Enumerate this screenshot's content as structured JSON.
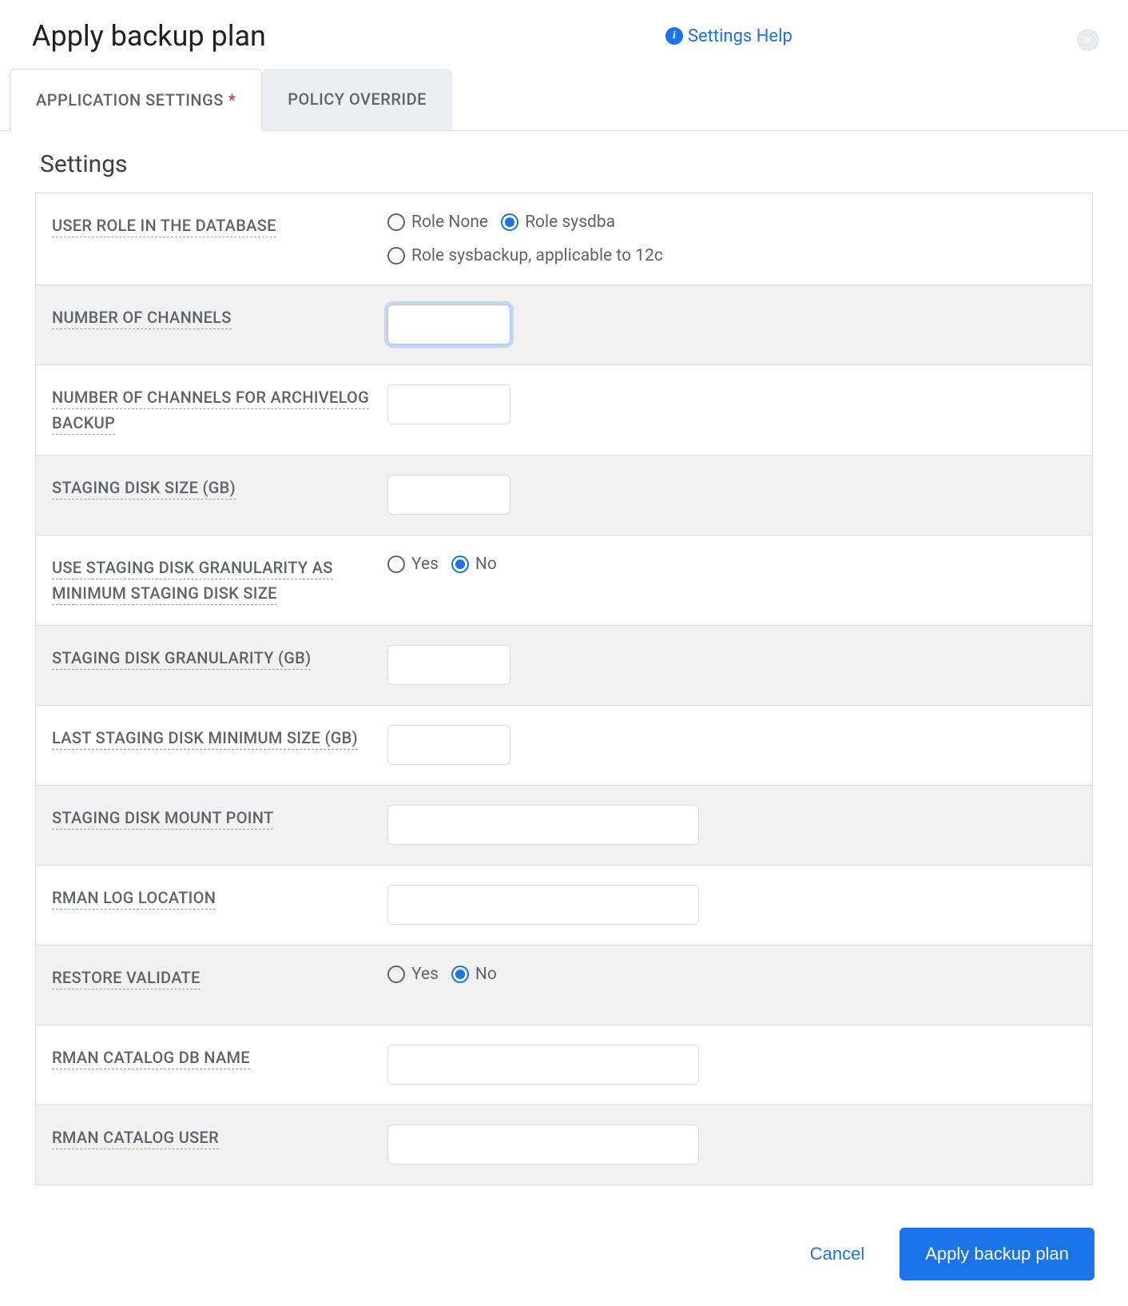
{
  "header": {
    "title": "Apply backup plan",
    "help_label": "Settings Help"
  },
  "tabs": [
    {
      "label": "APPLICATION SETTINGS",
      "required": true,
      "active": true
    },
    {
      "label": "POLICY OVERRIDE",
      "required": false,
      "active": false
    }
  ],
  "section_title": "Settings",
  "rows": [
    {
      "key": "user_role",
      "label": "USER ROLE IN THE DATABASE",
      "type": "radio",
      "options": [
        {
          "label": "Role None",
          "checked": false
        },
        {
          "label": "Role sysdba",
          "checked": true
        },
        {
          "label": "Role sysbackup, applicable to 12c",
          "checked": false
        }
      ]
    },
    {
      "key": "num_channels",
      "label": "NUMBER OF CHANNELS",
      "type": "text_small",
      "value": "",
      "focused": true
    },
    {
      "key": "num_channels_archivelog",
      "label": "NUMBER OF CHANNELS FOR ARCHIVELOG BACKUP",
      "type": "text_small",
      "value": ""
    },
    {
      "key": "staging_disk_size",
      "label": "STAGING DISK SIZE (GB)",
      "type": "text_small",
      "value": ""
    },
    {
      "key": "use_staging_granularity",
      "label": "USE STAGING DISK GRANULARITY AS MINIMUM STAGING DISK SIZE",
      "type": "radio",
      "options": [
        {
          "label": "Yes",
          "checked": false
        },
        {
          "label": "No",
          "checked": true
        }
      ]
    },
    {
      "key": "staging_granularity",
      "label": "STAGING DISK GRANULARITY (GB)",
      "type": "text_small",
      "value": ""
    },
    {
      "key": "last_staging_min_size",
      "label": "LAST STAGING DISK MINIMUM SIZE (GB)",
      "type": "text_small",
      "value": ""
    },
    {
      "key": "staging_mount_point",
      "label": "STAGING DISK MOUNT POINT",
      "type": "text_large",
      "value": ""
    },
    {
      "key": "rman_log_location",
      "label": "RMAN LOG LOCATION",
      "type": "text_large",
      "value": ""
    },
    {
      "key": "restore_validate",
      "label": "RESTORE VALIDATE",
      "type": "radio",
      "options": [
        {
          "label": "Yes",
          "checked": false
        },
        {
          "label": "No",
          "checked": true
        }
      ]
    },
    {
      "key": "rman_catalog_db",
      "label": "RMAN CATALOG DB NAME",
      "type": "text_large",
      "value": ""
    },
    {
      "key": "rman_catalog_user",
      "label": "RMAN CATALOG USER",
      "type": "text_large",
      "value": ""
    }
  ],
  "footer": {
    "cancel_label": "Cancel",
    "apply_label": "Apply backup plan"
  }
}
